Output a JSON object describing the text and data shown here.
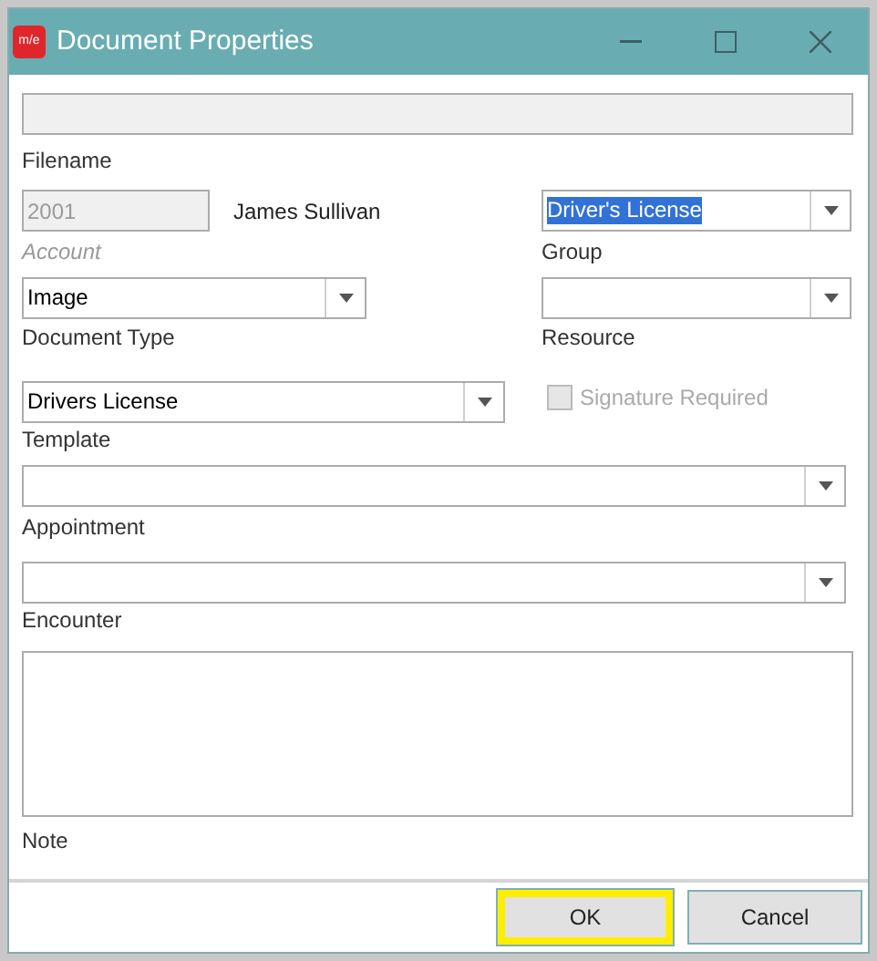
{
  "window": {
    "title": "Document Properties",
    "app_badge": "m/e"
  },
  "filename": {
    "label": "Filename",
    "disabled": true
  },
  "account": {
    "value": "2001",
    "label": "Account",
    "disabled": true,
    "patient_name": "James Sullivan"
  },
  "group": {
    "value": "Driver's License",
    "label": "Group",
    "text_selected": true
  },
  "document_type": {
    "value": "Image",
    "label": "Document Type"
  },
  "resource": {
    "label": "Resource"
  },
  "template": {
    "value": "Drivers License",
    "label": "Template"
  },
  "signature_required": {
    "label": "Signature Required",
    "checked": false,
    "disabled": true
  },
  "appointment": {
    "label": "Appointment"
  },
  "encounter": {
    "label": "Encounter"
  },
  "note": {
    "label": "Note"
  },
  "buttons": [
    {
      "label": "OK",
      "focused": true
    },
    {
      "label": "Cancel",
      "focused": false
    }
  ]
}
